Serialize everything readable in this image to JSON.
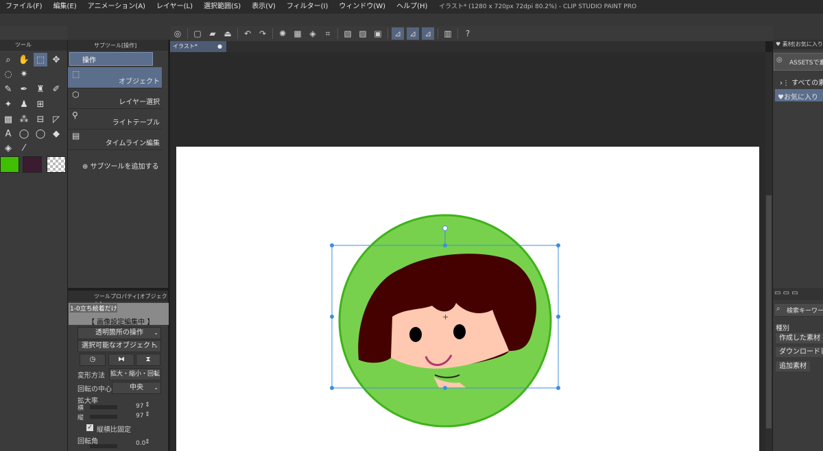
{
  "window": {
    "title": "イラスト* (1280 x 720px 72dpi 80.2%) - CLIP STUDIO PAINT PRO"
  },
  "menus": [
    "ファイル(F)",
    "編集(E)",
    "アニメーション(A)",
    "レイヤー(L)",
    "選択範囲(S)",
    "表示(V)",
    "フィルター(I)",
    "ウィンドウ(W)",
    "ヘルプ(H)"
  ],
  "tool_panel": {
    "tab": "ツール"
  },
  "subtool_panel": {
    "tab": "サブツール[操作]",
    "group": "操作",
    "items": [
      "オブジェクト",
      "レイヤー選択",
      "ライトテーブル",
      "タイムライン編集"
    ],
    "add_label": "サブツールを追加する"
  },
  "property_panel": {
    "tab": "ツールプロパティ[オブジェクト]",
    "layer_name": "1-0立ち絵着だけ",
    "status": "【 画像設定編集中 】",
    "transparent_op": "透明箇所の操作",
    "selectable": "選択可能なオブジェクト",
    "transform_label": "変形方法",
    "transform_value": "拡大・縮小・回転",
    "center_label": "回転の中心",
    "center_value": "中央",
    "scale_label": "拡大率",
    "width_label": "横",
    "width_value": "97",
    "height_label": "縦",
    "height_value": "97",
    "keep_ratio": "縦横比固定",
    "rotation_label": "回転角",
    "rotation_value": "0.0"
  },
  "document": {
    "tab": "イラスト*"
  },
  "materials_panel": {
    "tab": "素材[お気に入り]",
    "assets": "ASSETSで素材",
    "all": "すべての素材",
    "favorites": "お気に入り",
    "search": "検索キーワード",
    "category_label": "種別",
    "buttons": [
      "作成した素材",
      "ダウンロードした素材",
      "追加素材"
    ]
  },
  "colors": {
    "main": "#3fbf00",
    "sub": "#3a1b2f",
    "accent": "#5b6e8c",
    "circle": "#78d14c",
    "hair": "#450000",
    "skin": "#ffc8b0"
  },
  "icons": [
    "zoom",
    "hand",
    "operation",
    "move",
    "lasso",
    "auto-select",
    "eyedropper",
    "pen",
    "pencil",
    "brush",
    "airbrush",
    "blur",
    "fill",
    "text",
    "balloon",
    "eraser",
    "gradient",
    "ruler",
    "figure",
    "frame"
  ]
}
